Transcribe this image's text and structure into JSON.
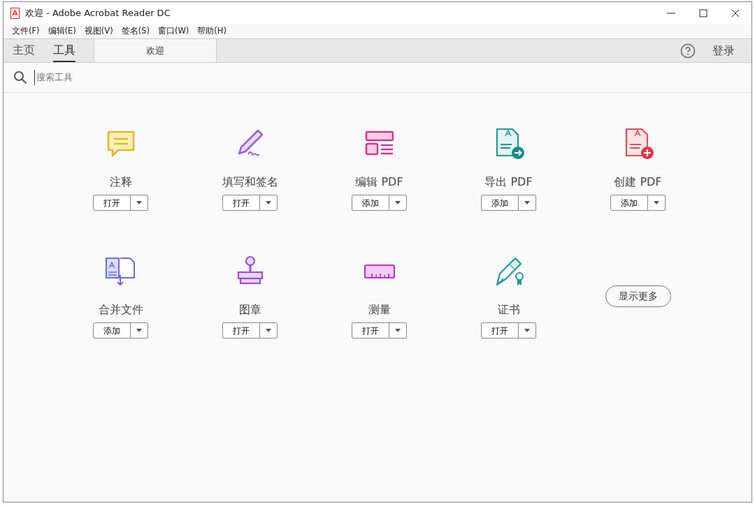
{
  "window": {
    "title": "欢迎 - Adobe Acrobat Reader DC"
  },
  "menu": [
    "文件(F)",
    "编辑(E)",
    "视图(V)",
    "签名(S)",
    "窗口(W)",
    "帮助(H)"
  ],
  "tabs": [
    {
      "label": "主页",
      "selected": false
    },
    {
      "label": "工具",
      "selected": true
    }
  ],
  "document_tab": {
    "label": "欢迎"
  },
  "sign_in": "登录",
  "search": {
    "placeholder": "搜索工具"
  },
  "tools": [
    {
      "kind": "comment",
      "name": "注释",
      "action": "打开"
    },
    {
      "kind": "sign",
      "name": "填写和签名",
      "action": "打开"
    },
    {
      "kind": "edit",
      "name": "编辑 PDF",
      "action": "添加"
    },
    {
      "kind": "export",
      "name": "导出 PDF",
      "action": "添加"
    },
    {
      "kind": "create",
      "name": "创建 PDF",
      "action": "添加"
    },
    {
      "kind": "combine",
      "name": "合并文件",
      "action": "添加"
    },
    {
      "kind": "stamp",
      "name": "图章",
      "action": "打开"
    },
    {
      "kind": "measure",
      "name": "测量",
      "action": "打开"
    },
    {
      "kind": "certificate",
      "name": "证书",
      "action": "打开"
    }
  ],
  "show_more": "显示更多"
}
